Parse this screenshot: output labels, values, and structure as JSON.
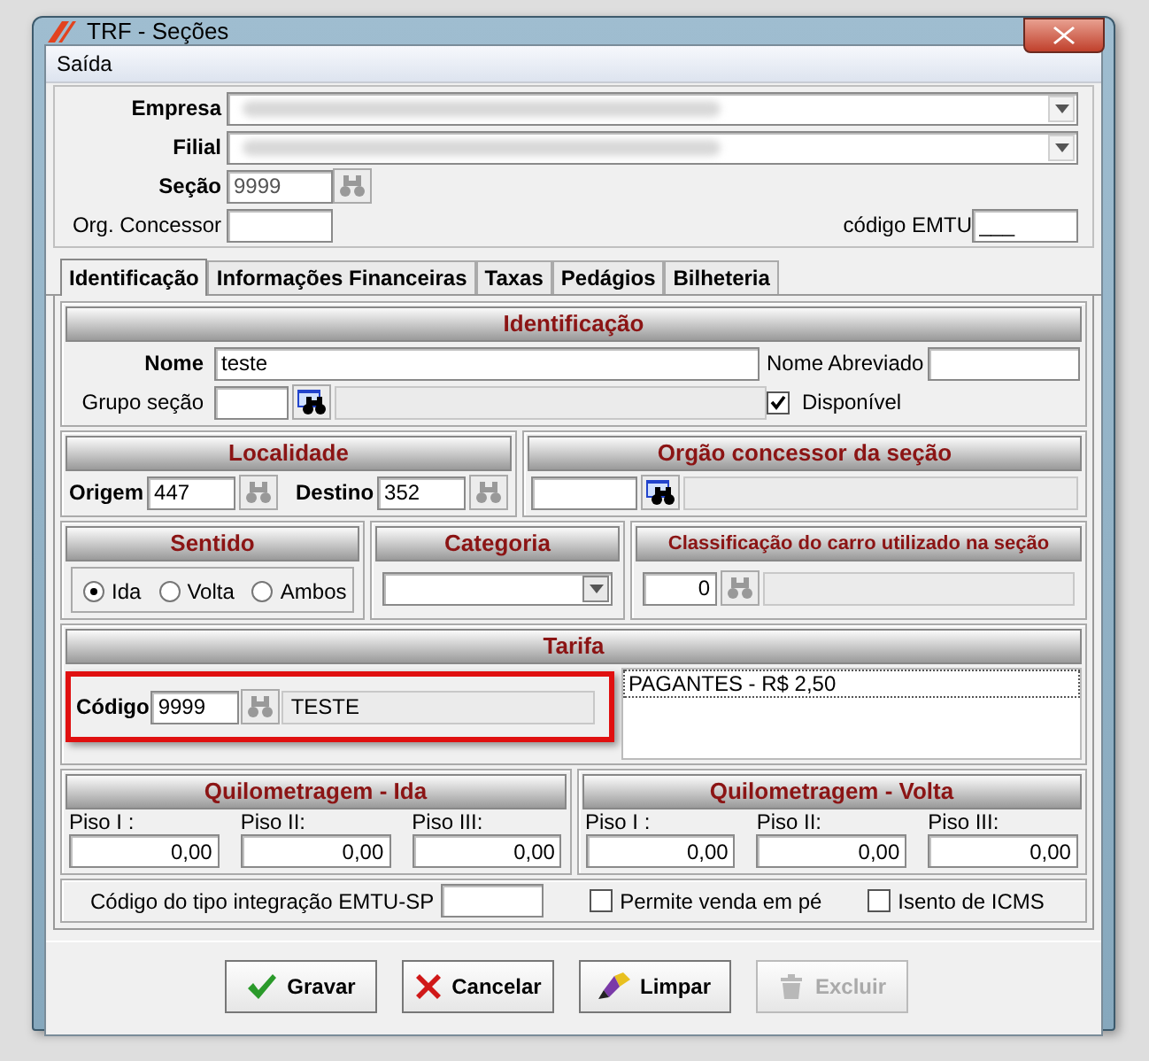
{
  "window": {
    "title": "TRF - Seções"
  },
  "menu": [
    {
      "label": "Saída"
    }
  ],
  "header": {
    "empresa": {
      "label": "Empresa"
    },
    "filial": {
      "label": "Filial"
    },
    "secao": {
      "label": "Seção",
      "value": "9999",
      "lookup_disabled": true
    },
    "org_concessor": {
      "label": "Org. Concessor"
    },
    "codigo_emtu": {
      "label": "código EMTU",
      "value": "___"
    }
  },
  "tabs": [
    {
      "label": "Identificação",
      "selected": true
    },
    {
      "label": "Informações Financeiras",
      "selected": false
    },
    {
      "label": "Taxas",
      "selected": false
    },
    {
      "label": "Pedágios",
      "selected": false
    },
    {
      "label": "Bilheteria",
      "selected": false
    }
  ],
  "identificacao": {
    "title": "Identificação",
    "nome": {
      "label": "Nome",
      "value": "teste"
    },
    "nome_abreviado": {
      "label": "Nome Abreviado"
    },
    "grupo_secao": {
      "label": "Grupo seção",
      "lookup_disabled": false
    },
    "disponivel": {
      "label": "Disponível",
      "checked": true
    }
  },
  "localidade": {
    "title": "Localidade",
    "origem": {
      "label": "Origem",
      "value": "447",
      "lookup_disabled": true
    },
    "destino": {
      "label": "Destino",
      "value": "352",
      "lookup_disabled": true
    }
  },
  "orgao_concessor": {
    "title": "Orgão concessor da seção",
    "lookup_disabled": false
  },
  "sentido": {
    "title": "Sentido",
    "options": [
      {
        "label": "Ida",
        "selected": true
      },
      {
        "label": "Volta",
        "selected": false
      },
      {
        "label": "Ambos",
        "selected": false
      }
    ]
  },
  "categoria": {
    "title": "Categoria"
  },
  "classificacao": {
    "title": "Classificação do carro utilizado na seção",
    "value": "0",
    "lookup_disabled": true
  },
  "tarifa": {
    "title": "Tarifa",
    "codigo": {
      "label": "Código",
      "value": "9999",
      "description": "TESTE",
      "lookup_disabled": true,
      "highlighted": true
    },
    "items": [
      {
        "text": "PAGANTES -  R$ 2,50",
        "selected": true
      }
    ]
  },
  "quilometragem": [
    {
      "title": "Quilometragem - Ida",
      "fields": [
        {
          "label": "Piso I :",
          "value": "0,00"
        },
        {
          "label": "Piso II:",
          "value": "0,00"
        },
        {
          "label": "Piso III:",
          "value": "0,00"
        }
      ]
    },
    {
      "title": "Quilometragem - Volta",
      "fields": [
        {
          "label": "Piso I :",
          "value": "0,00"
        },
        {
          "label": "Piso II:",
          "value": "0,00"
        },
        {
          "label": "Piso III:",
          "value": "0,00"
        }
      ]
    }
  ],
  "integracao": {
    "label": "Código do tipo integração EMTU-SP"
  },
  "options": [
    {
      "label": "Permite venda em pé",
      "checked": false
    },
    {
      "label": "Isento de ICMS",
      "checked": false
    }
  ],
  "buttons": [
    {
      "kind": "save",
      "label": "Gravar",
      "disabled": false
    },
    {
      "kind": "cancel",
      "label": "Cancelar",
      "disabled": false
    },
    {
      "kind": "clear",
      "label": "Limpar",
      "disabled": false
    },
    {
      "kind": "delete",
      "label": "Excluir",
      "disabled": true
    }
  ]
}
